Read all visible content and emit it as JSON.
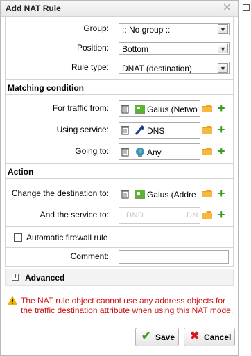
{
  "dialog": {
    "title": "Add NAT Rule",
    "close_glyph": "✕"
  },
  "fields": {
    "group": {
      "label": "Group:",
      "value": ":: No group ::"
    },
    "position": {
      "label": "Position:",
      "value": "Bottom"
    },
    "rule_type": {
      "label": "Rule type:",
      "value": "DNAT (destination)"
    }
  },
  "matching": {
    "heading": "Matching condition",
    "traffic_from": {
      "label": "For traffic from:",
      "object": "Gaius (Netwo",
      "icon": "network-object-icon"
    },
    "service": {
      "label": "Using service:",
      "object": "DNS",
      "icon": "service-icon"
    },
    "going_to": {
      "label": "Going to:",
      "object": "Any",
      "icon": "globe-icon"
    }
  },
  "action": {
    "heading": "Action",
    "change_destination": {
      "label": "Change the destination to:",
      "object": "Gaius (Addre",
      "icon": "network-object-icon"
    },
    "service_to": {
      "label": "And the service to:",
      "placeholder_left": "DND",
      "placeholder_right": "DN"
    }
  },
  "automatic_firewall": {
    "label": "Automatic firewall rule",
    "checked": false
  },
  "comment": {
    "label": "Comment:",
    "value": ""
  },
  "advanced": {
    "label": "Advanced",
    "expand_glyph": "+"
  },
  "warning": {
    "text": "The NAT rule object cannot use any address objects for the traffic destination attribute when using this NAT mode."
  },
  "buttons": {
    "save": "Save",
    "cancel": "Cancel"
  },
  "colors": {
    "add_green": "#3c9c1e",
    "warning_red": "#cc1010",
    "folder_orange": "#f0a020"
  }
}
